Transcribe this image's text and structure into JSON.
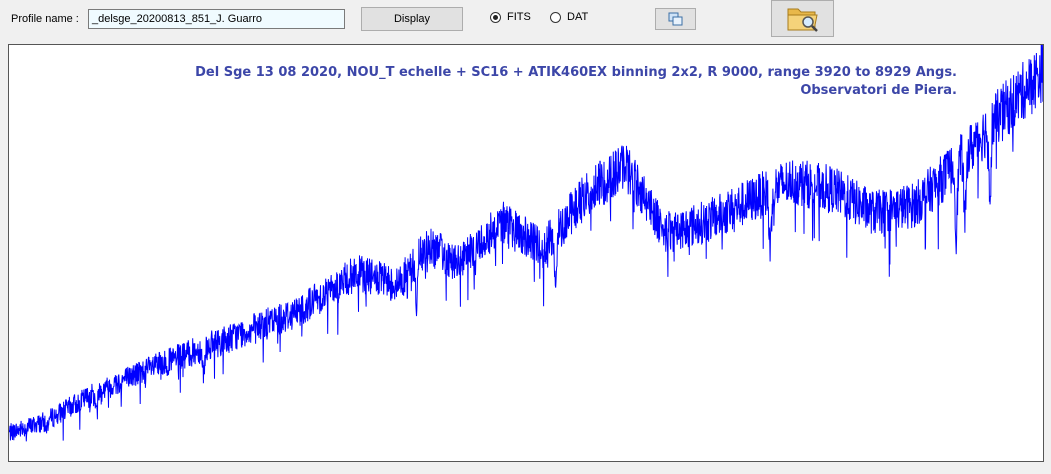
{
  "toolbar": {
    "profile_label": "Profile name :",
    "profile_value": "_delsge_20200813_851_J. Guarro",
    "display_label": "Display",
    "format_options": [
      "FITS",
      "DAT"
    ],
    "format_selected": "FITS",
    "copy_icon": "copy-window-icon",
    "open_icon": "folder-search-icon"
  },
  "plot": {
    "annotation_line1": "Del Sge 13 08 2020, NOU_T echelle  +  SC16  +   ATIK460EX binning 2x2,  R 9000,  range 3920 to 8929 Angs.",
    "annotation_line2": "Observatori de Piera.",
    "line_color": "#0000ff"
  },
  "chart_data": {
    "type": "line",
    "title": "Del Sge 13 08 2020, NOU_T echelle  +  SC16  +   ATIK460EX binning 2x2,  R 9000,  range 3920 to 8929 Angs.",
    "subtitle": "Observatori de Piera.",
    "xlabel": "",
    "ylabel": "",
    "xlim": [
      3920,
      8929
    ],
    "grid": false,
    "series": [
      {
        "x": [
          3920,
          4100,
          4300,
          4500,
          4700,
          4900,
          5100,
          5300,
          5600,
          5800,
          5950,
          6100,
          6300,
          6500,
          6700,
          6900,
          7100,
          7300,
          7500,
          7700,
          7900,
          8100,
          8300,
          8500,
          8700,
          8929
        ],
        "values": [
          0.05,
          0.08,
          0.14,
          0.19,
          0.23,
          0.27,
          0.31,
          0.35,
          0.45,
          0.42,
          0.52,
          0.47,
          0.58,
          0.51,
          0.64,
          0.72,
          0.55,
          0.58,
          0.63,
          0.68,
          0.66,
          0.6,
          0.62,
          0.72,
          0.84,
          0.96
        ]
      }
    ]
  }
}
